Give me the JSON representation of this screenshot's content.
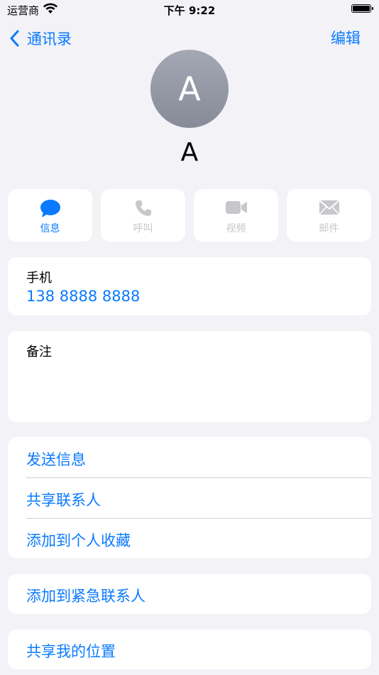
{
  "status_bar": {
    "carrier": "运营商",
    "time": "下午 9:22"
  },
  "nav": {
    "back_label": "通讯录",
    "edit_label": "编辑"
  },
  "contact": {
    "avatar_initial": "A",
    "name": "A"
  },
  "actions": [
    {
      "label": "信息",
      "icon": "message-icon",
      "enabled": true
    },
    {
      "label": "呼叫",
      "icon": "phone-icon",
      "enabled": false
    },
    {
      "label": "视频",
      "icon": "video-icon",
      "enabled": false
    },
    {
      "label": "邮件",
      "icon": "mail-icon",
      "enabled": false
    }
  ],
  "phone": {
    "label": "手机",
    "number": "138 8888 8888"
  },
  "notes": {
    "label": "备注"
  },
  "options_group_1": [
    "发送信息",
    "共享联系人",
    "添加到个人收藏"
  ],
  "options_group_2": [
    "添加到紧急联系人"
  ],
  "options_group_3": [
    "共享我的位置"
  ],
  "colors": {
    "accent": "#0a7aff",
    "background": "#f2f2f7",
    "disabled": "#c7c7cc"
  }
}
